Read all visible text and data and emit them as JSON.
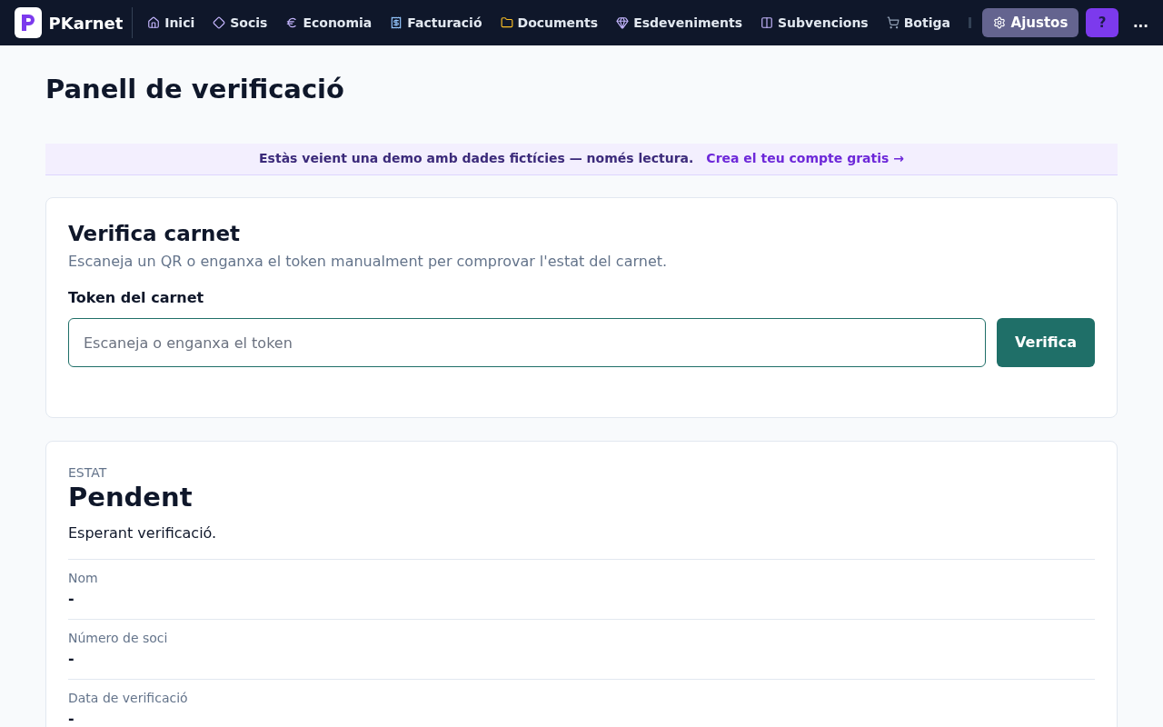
{
  "brand": {
    "name": "PKarnet"
  },
  "nav": [
    {
      "label": "Inici",
      "kind": "home"
    },
    {
      "label": "Socis",
      "kind": "diamond"
    },
    {
      "label": "Economia",
      "kind": "euro"
    },
    {
      "label": "Facturació",
      "kind": "receipt"
    },
    {
      "label": "Documents",
      "kind": "folder"
    },
    {
      "label": "Esdeveniments",
      "kind": "gem"
    },
    {
      "label": "Subvencions",
      "kind": "columns"
    },
    {
      "label": "Botiga",
      "kind": "cart"
    }
  ],
  "settings_button": "Ajustos",
  "help_button": "?",
  "more_button": "...",
  "page_title": "Panell de verificació",
  "demo_banner": {
    "text": "Estàs veient una demo amb dades fictícies — només lectura.",
    "link": "Crea el teu compte gratis →"
  },
  "verify_card": {
    "title": "Verifica carnet",
    "subtitle": "Escaneja un QR o enganxa el token manualment per comprovar l'estat del carnet.",
    "field_label": "Token del carnet",
    "placeholder": "Escaneja o enganxa el token",
    "button": "Verifica"
  },
  "status_card": {
    "label": "ESTAT",
    "status": "Pendent",
    "message": "Esperant verificació.",
    "fields": [
      {
        "label": "Nom",
        "value": "-"
      },
      {
        "label": "Número de soci",
        "value": "-"
      },
      {
        "label": "Data de verificació",
        "value": "-"
      }
    ]
  }
}
